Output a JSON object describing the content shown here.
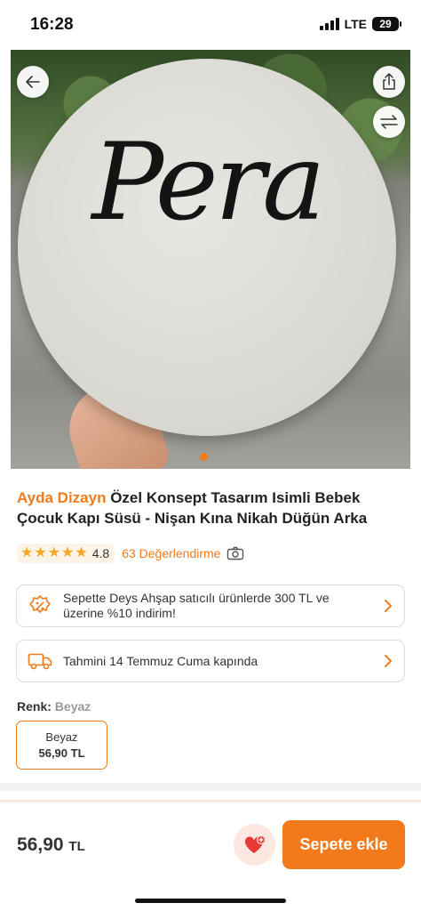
{
  "status_bar": {
    "time": "16:28",
    "network": "LTE",
    "battery": "29"
  },
  "product": {
    "image_text": "Pera",
    "brand": "Ayda Dizayn",
    "title": "Özel Konsept Tasarım Isimli Bebek Çocuk Kapı Süsü - Nişan Kına Nikah Düğün Arka",
    "rating": "4.8",
    "rating_stars": 4.8,
    "review_count_label": "63 Değerlendirme"
  },
  "cards": {
    "discount_text": "Sepette Deys Ahşap satıcılı ürünlerde 300 TL ve üzerine %10 indirim!",
    "delivery_text": "Tahmini 14 Temmuz Cuma kapında"
  },
  "color_section": {
    "label": "Renk:",
    "selected": "Beyaz",
    "variant": {
      "name": "Beyaz",
      "price": "56,90 TL"
    }
  },
  "bottom_bar": {
    "price": "56,90",
    "currency": "TL",
    "add_to_cart_label": "Sepete ekle"
  },
  "colors": {
    "accent": "#f27a1a",
    "star": "#f5a623",
    "favorite": "#e53935"
  }
}
